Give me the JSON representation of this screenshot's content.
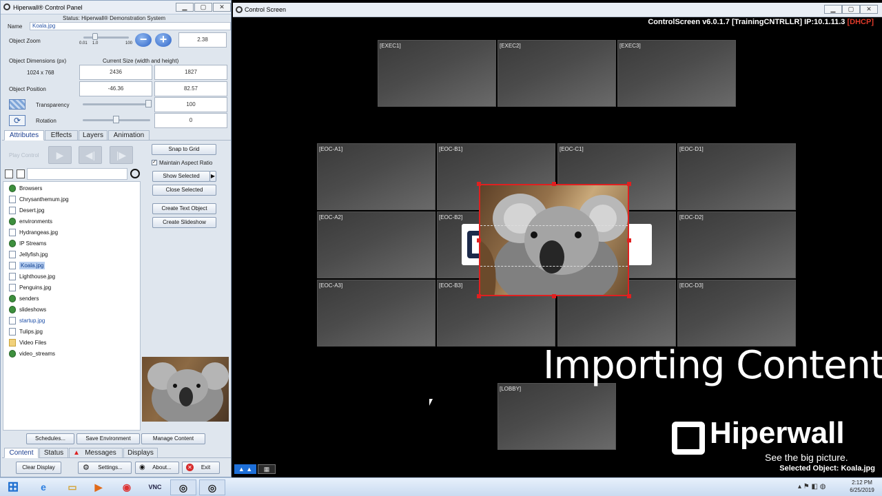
{
  "control_panel": {
    "title": "Hiperwall® Control Panel",
    "status": "Status: Hiperwall® Demonstration System",
    "name_label": "Name",
    "name_value": "Koala.jpg",
    "zoom_label": "Object Zoom",
    "zoom_ticks": [
      "0.01",
      "1.0",
      "100"
    ],
    "zoom_value": "2.38",
    "dims_label": "Object Dimensions (px)",
    "current_size_label": "Current Size (width and height)",
    "dims_value": "1024 x 768",
    "width": "2436",
    "height": "1827",
    "position_label": "Object Position",
    "pos_x": "-46.36",
    "pos_y": "82.57",
    "transparency_label": "Transparency",
    "transparency_value": "100",
    "rotation_label": "Rotation",
    "rotation_value": "0",
    "tabs": [
      "Attributes",
      "Effects",
      "Layers",
      "Animation"
    ],
    "play_control_label": "Play Control",
    "snap_label": "Snap to Grid",
    "aspect_label": "Maintain Aspect Ratio",
    "show_selected": "Show Selected",
    "close_selected": "Close Selected",
    "create_text": "Create Text Object",
    "create_slideshow": "Create Slideshow",
    "files": [
      "Browsers",
      "Chrysanthemum.jpg",
      "Desert.jpg",
      "environments",
      "Hydrangeas.jpg",
      "IP Streams",
      "Jellyfish.jpg",
      "Koala.jpg",
      "Lighthouse.jpg",
      "Penguins.jpg",
      "senders",
      "slideshows",
      "startup.jpg",
      "Tulips.jpg",
      "Video Files",
      "video_streams"
    ],
    "schedules": "Schedules...",
    "save_env": "Save Environment",
    "manage": "Manage Content",
    "bottom_tabs": [
      "Content",
      "Status",
      "Messages",
      "Displays"
    ],
    "clear_display": "Clear Display",
    "settings": "Settings...",
    "about": "About...",
    "exit": "Exit"
  },
  "control_screen": {
    "title": "Control Screen",
    "version": "ControlScreen v6.0.1.7 [TrainingCNTRLLR] IP:10.1.11.3",
    "dhcp": "[DHCP]",
    "tiles": [
      "[EXEC1]",
      "[EXEC2]",
      "[EXEC3]",
      "[EOC-A1]",
      "[EOC-B1]",
      "[EOC-C1]",
      "[EOC-D1]",
      "[EOC-A2]",
      "[EOC-B2]",
      "[EOC-D2]",
      "[EOC-A3]",
      "[EOC-B3]",
      "[EOC-D3]",
      "[LOBBY]"
    ],
    "overlay_title": "Importing Content",
    "brand": "Hiperwall",
    "tagline": "See the big picture.",
    "selected_object": "Selected Object: Koala.jpg"
  },
  "taskbar": {
    "time": "2:12 PM",
    "date": "6/25/2019"
  },
  "colors": {
    "accent": "#1a3d8f",
    "dhcp": "#e03a2a",
    "selection": "#e02020"
  }
}
